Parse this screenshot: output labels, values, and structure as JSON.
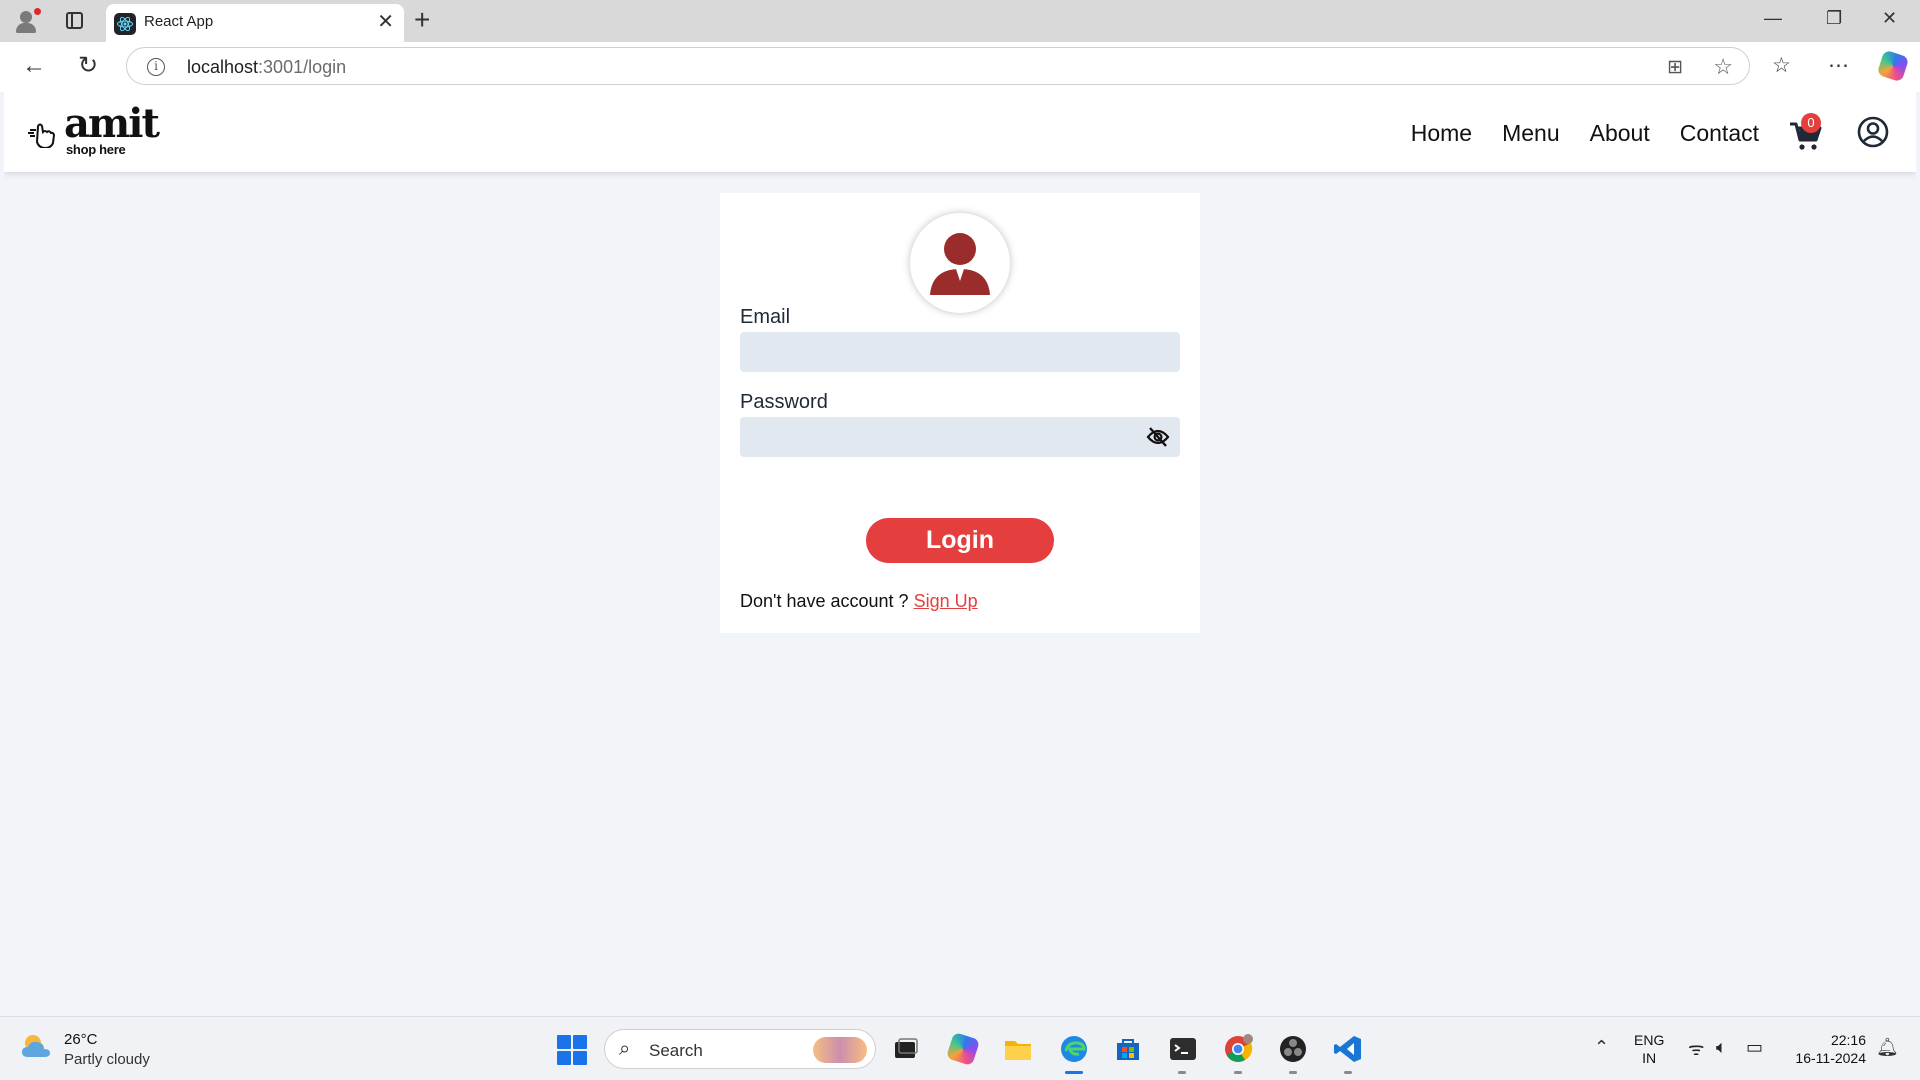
{
  "browser": {
    "tab_title": "React App",
    "url_host": "localhost",
    "url_path": ":3001/login"
  },
  "app": {
    "logo_text": "amit",
    "logo_tagline": "shop here",
    "nav": [
      "Home",
      "Menu",
      "About",
      "Contact"
    ],
    "cart_count": "0"
  },
  "login": {
    "email_label": "Email",
    "email_value": "",
    "password_label": "Password",
    "password_value": "",
    "button_label": "Login",
    "no_account_text": "Don't have account ?",
    "signup_link": "Sign Up"
  },
  "taskbar": {
    "weather_temp": "26°C",
    "weather_desc": "Partly cloudy",
    "search_placeholder": "Search",
    "lang_line1": "ENG",
    "lang_line2": "IN",
    "time": "22:16",
    "date": "16-11-2024"
  },
  "colors": {
    "accent_red": "#e53e3e",
    "avatar_red": "#9b2c2c",
    "field_bg": "#e2e8f0",
    "page_bg": "#f1f5f9"
  }
}
